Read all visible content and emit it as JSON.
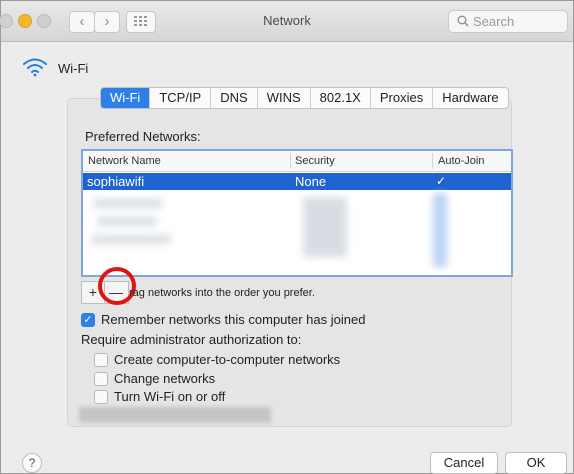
{
  "window": {
    "title": "Network"
  },
  "search": {
    "placeholder": "Search"
  },
  "header": {
    "label": "Wi-Fi"
  },
  "tabs": [
    {
      "label": "Wi-Fi",
      "active": true
    },
    {
      "label": "TCP/IP"
    },
    {
      "label": "DNS"
    },
    {
      "label": "WINS"
    },
    {
      "label": "802.1X"
    },
    {
      "label": "Proxies"
    },
    {
      "label": "Hardware"
    }
  ],
  "preferred": {
    "title": "Preferred Networks:",
    "columns": {
      "name": "Network Name",
      "security": "Security",
      "auto_join": "Auto-Join"
    },
    "selected_row": {
      "name": "sophiawifi",
      "security": "None",
      "auto_join": true
    }
  },
  "controls": {
    "plus": "+",
    "minus": "—",
    "drag_hint": "rag networks into the order you prefer."
  },
  "options": {
    "remember": {
      "label": "Remember networks this computer has joined",
      "checked": true
    },
    "require_title": "Require administrator authorization to:",
    "admin": [
      {
        "label": "Create computer-to-computer networks",
        "checked": false
      },
      {
        "label": "Change networks",
        "checked": false
      },
      {
        "label": "Turn Wi-Fi on or off",
        "checked": false
      }
    ]
  },
  "footer": {
    "help": "?",
    "cancel": "Cancel",
    "ok": "OK"
  },
  "colors": {
    "accent": "#2e7fe8",
    "selection": "#1e63cf",
    "annotation": "#e01414"
  }
}
